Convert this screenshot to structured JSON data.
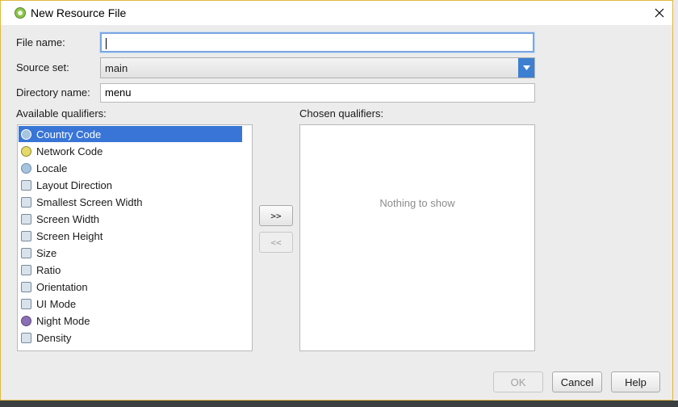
{
  "window": {
    "title": "New Resource File"
  },
  "form": {
    "file_name_label": "File name:",
    "file_name_value": "",
    "source_set_label": "Source set:",
    "source_set_value": "main",
    "directory_label": "Directory name:",
    "directory_value": "menu"
  },
  "available": {
    "label": "Available qualifiers:",
    "items": [
      {
        "label": "Country Code",
        "icon": "country-code-icon",
        "selected": true
      },
      {
        "label": "Network Code",
        "icon": "network-code-icon"
      },
      {
        "label": "Locale",
        "icon": "globe-icon"
      },
      {
        "label": "Layout Direction",
        "icon": "layout-direction-icon"
      },
      {
        "label": "Smallest Screen Width",
        "icon": "smallest-width-icon"
      },
      {
        "label": "Screen Width",
        "icon": "screen-width-icon"
      },
      {
        "label": "Screen Height",
        "icon": "screen-height-icon"
      },
      {
        "label": "Size",
        "icon": "size-icon"
      },
      {
        "label": "Ratio",
        "icon": "ratio-icon"
      },
      {
        "label": "Orientation",
        "icon": "orientation-icon"
      },
      {
        "label": "UI Mode",
        "icon": "ui-mode-icon"
      },
      {
        "label": "Night Mode",
        "icon": "moon-icon"
      },
      {
        "label": "Density",
        "icon": "density-icon"
      }
    ]
  },
  "transfer": {
    "add_label": ">>",
    "remove_label": "<<"
  },
  "chosen": {
    "label": "Chosen qualifiers:",
    "empty_text": "Nothing to show"
  },
  "buttons": {
    "ok": "OK",
    "cancel": "Cancel",
    "help": "Help"
  },
  "colors": {
    "selection": "#3875d7",
    "dropdown_arrow": "#3d7fd1",
    "focus": "#7aa7e0"
  }
}
